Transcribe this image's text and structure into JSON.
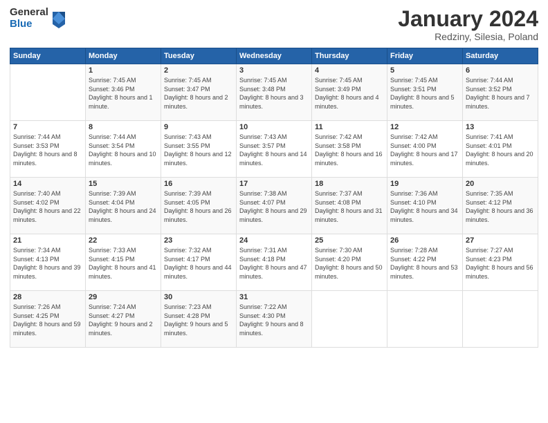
{
  "header": {
    "logo_general": "General",
    "logo_blue": "Blue",
    "month_title": "January 2024",
    "location": "Redziny, Silesia, Poland"
  },
  "days_of_week": [
    "Sunday",
    "Monday",
    "Tuesday",
    "Wednesday",
    "Thursday",
    "Friday",
    "Saturday"
  ],
  "weeks": [
    [
      {
        "day": "",
        "sunrise": "",
        "sunset": "",
        "daylight": ""
      },
      {
        "day": "1",
        "sunrise": "Sunrise: 7:45 AM",
        "sunset": "Sunset: 3:46 PM",
        "daylight": "Daylight: 8 hours and 1 minute."
      },
      {
        "day": "2",
        "sunrise": "Sunrise: 7:45 AM",
        "sunset": "Sunset: 3:47 PM",
        "daylight": "Daylight: 8 hours and 2 minutes."
      },
      {
        "day": "3",
        "sunrise": "Sunrise: 7:45 AM",
        "sunset": "Sunset: 3:48 PM",
        "daylight": "Daylight: 8 hours and 3 minutes."
      },
      {
        "day": "4",
        "sunrise": "Sunrise: 7:45 AM",
        "sunset": "Sunset: 3:49 PM",
        "daylight": "Daylight: 8 hours and 4 minutes."
      },
      {
        "day": "5",
        "sunrise": "Sunrise: 7:45 AM",
        "sunset": "Sunset: 3:51 PM",
        "daylight": "Daylight: 8 hours and 5 minutes."
      },
      {
        "day": "6",
        "sunrise": "Sunrise: 7:44 AM",
        "sunset": "Sunset: 3:52 PM",
        "daylight": "Daylight: 8 hours and 7 minutes."
      }
    ],
    [
      {
        "day": "7",
        "sunrise": "Sunrise: 7:44 AM",
        "sunset": "Sunset: 3:53 PM",
        "daylight": "Daylight: 8 hours and 8 minutes."
      },
      {
        "day": "8",
        "sunrise": "Sunrise: 7:44 AM",
        "sunset": "Sunset: 3:54 PM",
        "daylight": "Daylight: 8 hours and 10 minutes."
      },
      {
        "day": "9",
        "sunrise": "Sunrise: 7:43 AM",
        "sunset": "Sunset: 3:55 PM",
        "daylight": "Daylight: 8 hours and 12 minutes."
      },
      {
        "day": "10",
        "sunrise": "Sunrise: 7:43 AM",
        "sunset": "Sunset: 3:57 PM",
        "daylight": "Daylight: 8 hours and 14 minutes."
      },
      {
        "day": "11",
        "sunrise": "Sunrise: 7:42 AM",
        "sunset": "Sunset: 3:58 PM",
        "daylight": "Daylight: 8 hours and 16 minutes."
      },
      {
        "day": "12",
        "sunrise": "Sunrise: 7:42 AM",
        "sunset": "Sunset: 4:00 PM",
        "daylight": "Daylight: 8 hours and 17 minutes."
      },
      {
        "day": "13",
        "sunrise": "Sunrise: 7:41 AM",
        "sunset": "Sunset: 4:01 PM",
        "daylight": "Daylight: 8 hours and 20 minutes."
      }
    ],
    [
      {
        "day": "14",
        "sunrise": "Sunrise: 7:40 AM",
        "sunset": "Sunset: 4:02 PM",
        "daylight": "Daylight: 8 hours and 22 minutes."
      },
      {
        "day": "15",
        "sunrise": "Sunrise: 7:39 AM",
        "sunset": "Sunset: 4:04 PM",
        "daylight": "Daylight: 8 hours and 24 minutes."
      },
      {
        "day": "16",
        "sunrise": "Sunrise: 7:39 AM",
        "sunset": "Sunset: 4:05 PM",
        "daylight": "Daylight: 8 hours and 26 minutes."
      },
      {
        "day": "17",
        "sunrise": "Sunrise: 7:38 AM",
        "sunset": "Sunset: 4:07 PM",
        "daylight": "Daylight: 8 hours and 29 minutes."
      },
      {
        "day": "18",
        "sunrise": "Sunrise: 7:37 AM",
        "sunset": "Sunset: 4:08 PM",
        "daylight": "Daylight: 8 hours and 31 minutes."
      },
      {
        "day": "19",
        "sunrise": "Sunrise: 7:36 AM",
        "sunset": "Sunset: 4:10 PM",
        "daylight": "Daylight: 8 hours and 34 minutes."
      },
      {
        "day": "20",
        "sunrise": "Sunrise: 7:35 AM",
        "sunset": "Sunset: 4:12 PM",
        "daylight": "Daylight: 8 hours and 36 minutes."
      }
    ],
    [
      {
        "day": "21",
        "sunrise": "Sunrise: 7:34 AM",
        "sunset": "Sunset: 4:13 PM",
        "daylight": "Daylight: 8 hours and 39 minutes."
      },
      {
        "day": "22",
        "sunrise": "Sunrise: 7:33 AM",
        "sunset": "Sunset: 4:15 PM",
        "daylight": "Daylight: 8 hours and 41 minutes."
      },
      {
        "day": "23",
        "sunrise": "Sunrise: 7:32 AM",
        "sunset": "Sunset: 4:17 PM",
        "daylight": "Daylight: 8 hours and 44 minutes."
      },
      {
        "day": "24",
        "sunrise": "Sunrise: 7:31 AM",
        "sunset": "Sunset: 4:18 PM",
        "daylight": "Daylight: 8 hours and 47 minutes."
      },
      {
        "day": "25",
        "sunrise": "Sunrise: 7:30 AM",
        "sunset": "Sunset: 4:20 PM",
        "daylight": "Daylight: 8 hours and 50 minutes."
      },
      {
        "day": "26",
        "sunrise": "Sunrise: 7:28 AM",
        "sunset": "Sunset: 4:22 PM",
        "daylight": "Daylight: 8 hours and 53 minutes."
      },
      {
        "day": "27",
        "sunrise": "Sunrise: 7:27 AM",
        "sunset": "Sunset: 4:23 PM",
        "daylight": "Daylight: 8 hours and 56 minutes."
      }
    ],
    [
      {
        "day": "28",
        "sunrise": "Sunrise: 7:26 AM",
        "sunset": "Sunset: 4:25 PM",
        "daylight": "Daylight: 8 hours and 59 minutes."
      },
      {
        "day": "29",
        "sunrise": "Sunrise: 7:24 AM",
        "sunset": "Sunset: 4:27 PM",
        "daylight": "Daylight: 9 hours and 2 minutes."
      },
      {
        "day": "30",
        "sunrise": "Sunrise: 7:23 AM",
        "sunset": "Sunset: 4:28 PM",
        "daylight": "Daylight: 9 hours and 5 minutes."
      },
      {
        "day": "31",
        "sunrise": "Sunrise: 7:22 AM",
        "sunset": "Sunset: 4:30 PM",
        "daylight": "Daylight: 9 hours and 8 minutes."
      },
      {
        "day": "",
        "sunrise": "",
        "sunset": "",
        "daylight": ""
      },
      {
        "day": "",
        "sunrise": "",
        "sunset": "",
        "daylight": ""
      },
      {
        "day": "",
        "sunrise": "",
        "sunset": "",
        "daylight": ""
      }
    ]
  ]
}
